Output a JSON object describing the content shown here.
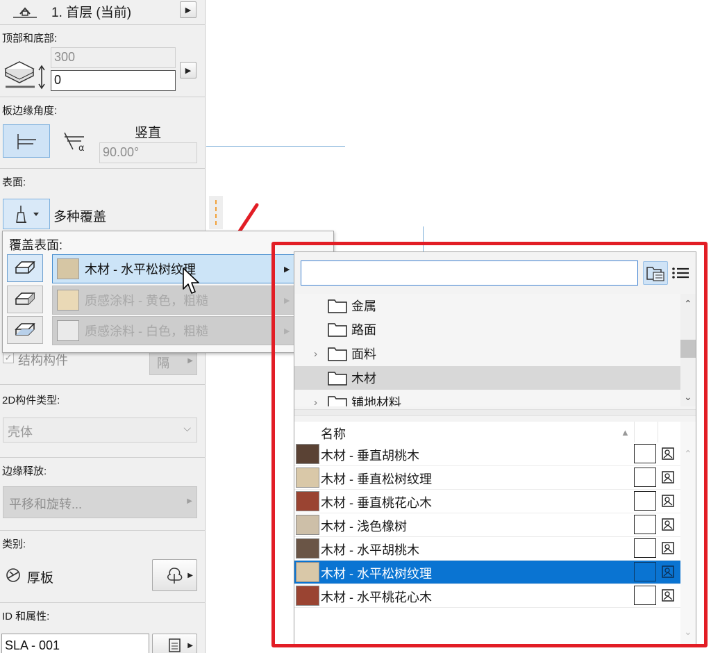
{
  "story": {
    "label": "1. 首层 (当前)"
  },
  "top_bottom": {
    "label": "顶部和底部:",
    "height_value": "300",
    "offset_value": "0"
  },
  "edge_angle": {
    "label": "板边缘角度:",
    "mode_label": "竖直",
    "angle_value": "90.00°"
  },
  "surface": {
    "label": "表面:",
    "value": "多种覆盖"
  },
  "structural": {
    "label": "结构构件",
    "button_text": "隔"
  },
  "type_2d": {
    "label": "2D构件类型:",
    "value": "壳体"
  },
  "edge_release": {
    "label": "边缘释放:",
    "value": "平移和旋转..."
  },
  "category": {
    "label": "类别:",
    "value": "厚板"
  },
  "id_props": {
    "label": "ID 和属性:",
    "id_value": "SLA - 001"
  },
  "surface_popup": {
    "title": "覆盖表面:",
    "rows": [
      {
        "name": "木材 - 水平松树纹理",
        "color": "#d6c6a4"
      },
      {
        "name": "质感涂料 - 黄色，粗糙",
        "color": "#ead9b6"
      },
      {
        "name": "质感涂料 - 白色，粗糙",
        "color": "#eaeaea"
      }
    ]
  },
  "browser": {
    "search_value": "",
    "folders": [
      {
        "name": "金属",
        "chevron": ""
      },
      {
        "name": "路面",
        "chevron": ""
      },
      {
        "name": "面料",
        "chevron": "›"
      },
      {
        "name": "木材",
        "chevron": ""
      },
      {
        "name": "铺地材料",
        "chevron": "›"
      }
    ],
    "column_name": "名称",
    "materials": [
      {
        "name": "木材 - 垂直胡桃木",
        "color": "#5a4234"
      },
      {
        "name": "木材 - 垂直松树纹理",
        "color": "#d9c8a8"
      },
      {
        "name": "木材 - 垂直桃花心木",
        "color": "#9a4432"
      },
      {
        "name": "木材 - 浅色橡树",
        "color": "#cdbfa8"
      },
      {
        "name": "木材 - 水平胡桃木",
        "color": "#6a5546"
      },
      {
        "name": "木材 - 水平松树纹理",
        "color": "#d9c8a8"
      },
      {
        "name": "木材 - 水平桃花心木",
        "color": "#9a4432"
      }
    ]
  },
  "colors": {
    "highlight": "#e21d25",
    "selection": "#0a74d2",
    "arrow": "#e21d25"
  }
}
